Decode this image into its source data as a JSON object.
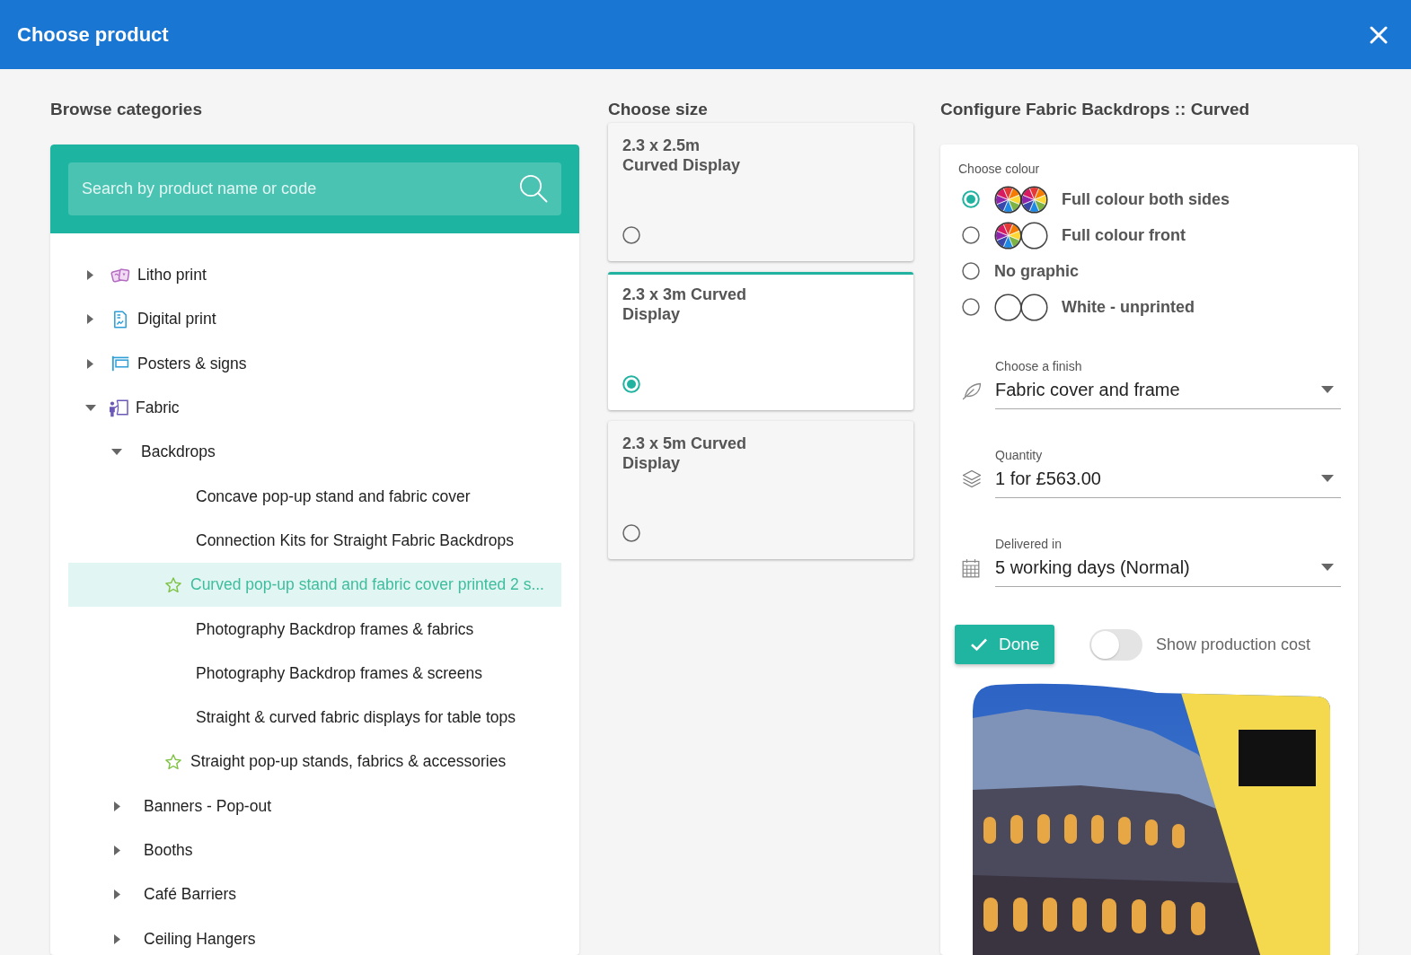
{
  "header": {
    "title": "Choose product"
  },
  "browse": {
    "heading": "Browse categories",
    "search": {
      "placeholder": "Search by product name or code"
    },
    "tree": [
      {
        "label": "Litho print",
        "kind": "litho",
        "expanded": false,
        "selected": false
      },
      {
        "label": "Digital print",
        "kind": "digital",
        "expanded": false,
        "selected": false
      },
      {
        "label": "Posters & signs",
        "kind": "poster",
        "expanded": false,
        "selected": false
      },
      {
        "label": "Fabric",
        "kind": "fabric",
        "expanded": true,
        "selected": false,
        "children": [
          {
            "label": "Backdrops",
            "expanded": true,
            "selected": false,
            "children": [
              {
                "label": "Concave pop-up stand and fabric cover",
                "starred": false,
                "selected": false
              },
              {
                "label": "Connection Kits for Straight Fabric Backdrops",
                "starred": false,
                "selected": false
              },
              {
                "label": "Curved pop-up stand and fabric cover printed 2 s...",
                "starred": true,
                "selected": true
              },
              {
                "label": "Photography Backdrop frames & fabrics",
                "starred": false,
                "selected": false
              },
              {
                "label": "Photography Backdrop frames & screens",
                "starred": false,
                "selected": false
              },
              {
                "label": "Straight & curved fabric displays for table tops",
                "starred": false,
                "selected": false
              },
              {
                "label": "Straight pop-up stands, fabrics & accessories",
                "starred": true,
                "selected": false
              }
            ]
          },
          {
            "label": "Banners - Pop-out",
            "expanded": false,
            "selected": false
          },
          {
            "label": "Booths",
            "expanded": false,
            "selected": false
          },
          {
            "label": "Café Barriers",
            "expanded": false,
            "selected": false
          },
          {
            "label": "Ceiling Hangers",
            "expanded": false,
            "selected": false
          }
        ]
      }
    ]
  },
  "size": {
    "heading": "Choose size",
    "options": [
      {
        "label": "2.3 x 2.5m Curved Display",
        "selected": false
      },
      {
        "label": "2.3 x 3m Curved Display",
        "selected": true
      },
      {
        "label": "2.3 x 5m Curved Display",
        "selected": false
      }
    ]
  },
  "configure": {
    "heading": "Configure Fabric Backdrops :: Curved",
    "colour_label": "Choose colour",
    "colour_options": [
      {
        "label": "Full colour both sides",
        "kind": "both",
        "selected": true
      },
      {
        "label": "Full colour front",
        "kind": "front",
        "selected": false
      },
      {
        "label": "No graphic",
        "kind": "none",
        "selected": false
      },
      {
        "label": "White - unprinted",
        "kind": "white",
        "selected": false
      }
    ],
    "fields": [
      {
        "kind": "finish",
        "label": "Choose a finish",
        "value": "Fabric cover and frame"
      },
      {
        "kind": "quantity",
        "label": "Quantity",
        "value": "1 for £563.00"
      },
      {
        "kind": "delivery",
        "label": "Delivered in",
        "value": "5 working days (Normal)"
      }
    ],
    "done_button": {
      "label": "Done"
    },
    "toggle": {
      "label": "Show production cost",
      "on": false
    }
  }
}
